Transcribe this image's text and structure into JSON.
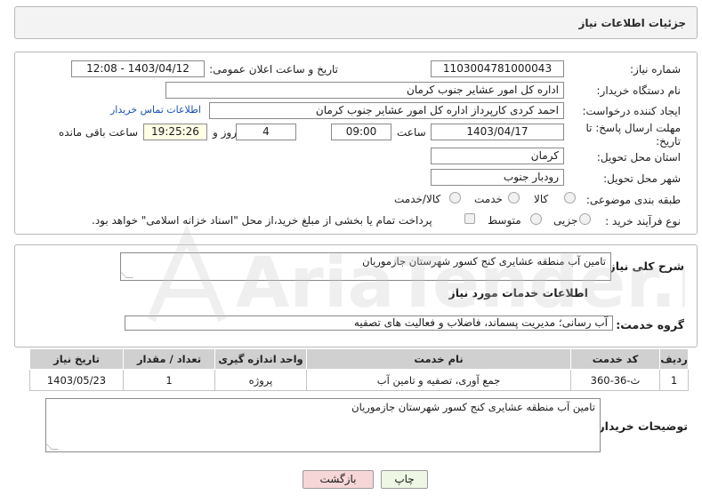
{
  "header": {
    "title": "جزئیات اطلاعات نیاز"
  },
  "need_number": {
    "label": "شماره نیاز:",
    "value": "1103004781000043"
  },
  "announce_datetime": {
    "label": "تاریخ و ساعت اعلان عمومی:",
    "value": "1403/04/12 - 12:08"
  },
  "buyer_org": {
    "label": "نام دستگاه خریدار:",
    "value": "اداره کل امور عشایر جنوب کرمان"
  },
  "requester": {
    "label": "ایجاد کننده درخواست:",
    "value": "احمد کردی   کارپرداز اداره کل امور عشایر جنوب کرمان",
    "contact_link": "اطلاعات تماس خریدار"
  },
  "deadline": {
    "label": "مهلت ارسال پاسخ: تا تاریخ:",
    "date": "1403/04/17",
    "time_label": "ساعت",
    "time": "09:00",
    "days": "4",
    "days_label": "روز و",
    "remaining": "19:25:26",
    "remaining_label": "ساعت باقی مانده"
  },
  "province": {
    "label": "استان محل تحویل:",
    "value": "کرمان"
  },
  "city": {
    "label": "شهر محل تحویل:",
    "value": "رودبار جنوب"
  },
  "category": {
    "label": "طبقه بندی موضوعی:",
    "options": [
      "کالا",
      "خدمت",
      "کالا/خدمت"
    ]
  },
  "process": {
    "label": "نوع فرآیند خرید :",
    "options": [
      "جزیی",
      "متوسط"
    ],
    "payment_note": "پرداخت تمام یا بخشی از مبلغ خرید،از محل \"اسناد خزانه اسلامی\" خواهد بود."
  },
  "summary": {
    "label": "شرح کلی نیاز:",
    "value": "تامین آب منطقه عشایری کنج کسور شهرستان جازموریان"
  },
  "services_heading": "اطلاعات خدمات مورد نیاز",
  "service_group": {
    "label": "گروه خدمت:",
    "value": "آب رسانی؛ مدیریت پسماند، فاضلاب و فعالیت های تصفیه"
  },
  "table": {
    "headers": [
      "ردیف",
      "کد خدمت",
      "نام خدمت",
      "واحد اندازه گیری",
      "تعداد / مقدار",
      "تاریخ نیاز"
    ],
    "rows": [
      [
        "1",
        "ث-36-360",
        "جمع آوری، تصفیه و تامین آب",
        "پروژه",
        "1",
        "1403/05/23"
      ]
    ]
  },
  "buyer_notes": {
    "label": "توضیحات خریدار:",
    "value": "تامین آب منطقه عشایری کنج کسور شهرستان جازموریان"
  },
  "buttons": {
    "print": "چاپ",
    "back": "بازگشت"
  },
  "watermark": {
    "text": "AriaTender.neT"
  },
  "colors": {
    "link": "#1a4fb5",
    "table_header": "#d0d0d0",
    "back_button": "#f6d6d6",
    "print_button": "#eef6e4"
  }
}
